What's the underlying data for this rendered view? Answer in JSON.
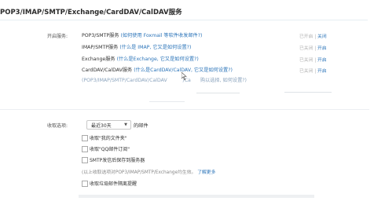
{
  "header": {
    "title": "POP3/IMAP/SMTP/Exchange/CardDAV/CalDAV服务"
  },
  "services": {
    "label": "开启服务:",
    "items": [
      {
        "name": "POP3/SMTP服务",
        "help": "(如何使用 Foxmail 等软件收发邮件?)",
        "status": "已开启",
        "sep": "|",
        "action": "关闭"
      },
      {
        "name": "IMAP/SMTP服务",
        "help": "(什么是 IMAP, 它又是如何设置?)",
        "status": "已关闭",
        "sep": "|",
        "action": "开启"
      },
      {
        "name": "Exchange服务",
        "help": "(什么是Exchange, 它又是如何设置?)",
        "status": "已关闭",
        "sep": "|",
        "action": "开启"
      },
      {
        "name": "CardDAV/CalDAV服务",
        "help": "(什么是CardDAV/CalDAV, 它又是如何设置?)",
        "status": "已关闭",
        "sep": "|",
        "action": "开启"
      }
    ],
    "partial_line": "(POP3/IMAP/SMTP/CardDAV/CalDAV",
    "partial_tail": "/Ca",
    "partial_end": "购以选择, 如何设置?)"
  },
  "receive": {
    "label": "收取选项:",
    "select_value": "最近30天",
    "select_suffix": "的邮件",
    "options": [
      "收取\"我的文件夹\"",
      "收取\"QQ邮件订阅\"",
      "SMTP发信后保存到服务器"
    ],
    "note_text": "(以上收取选项对POP3/IMAP/SMTP/Exchange均生效。",
    "note_link": "了解更多",
    "last_option": "收取垃圾邮件隔离提醒"
  }
}
